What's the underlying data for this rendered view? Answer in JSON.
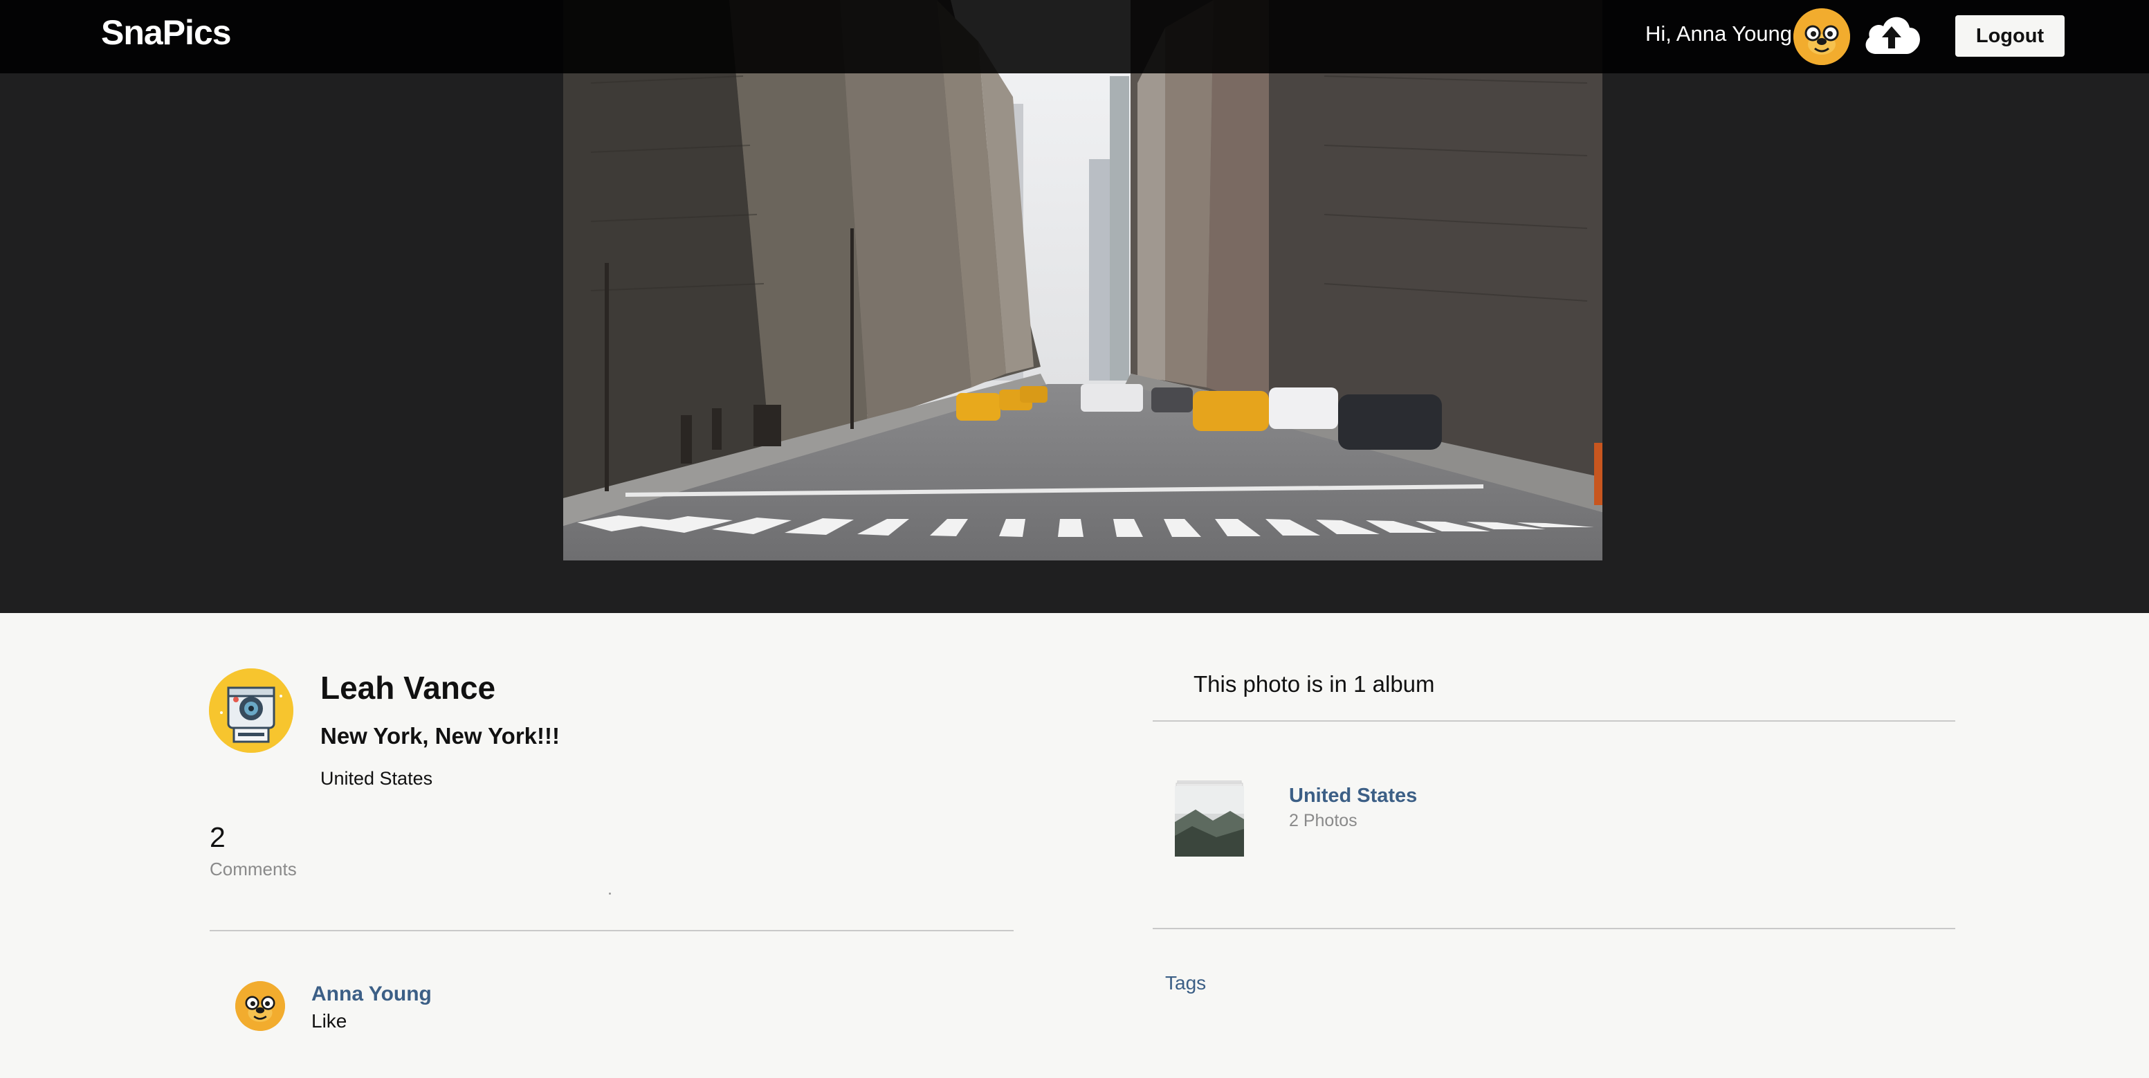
{
  "app": {
    "name": "SnaPics"
  },
  "header": {
    "greeting": "Hi, Anna Young",
    "avatar_icon": "jake-dog-avatar-icon",
    "upload_icon": "cloud-upload-icon",
    "logout_label": "Logout"
  },
  "photo": {
    "author": "Leah Vance",
    "title": "New York, New York!!!",
    "location": "United States",
    "comments_count": "2",
    "comments_label": "Comments"
  },
  "comments": [
    {
      "author": "Anna Young",
      "text": "Like"
    }
  ],
  "albums": {
    "heading": "This photo is in 1 album",
    "items": [
      {
        "name": "United States",
        "count_label": "2 Photos"
      }
    ]
  },
  "tags": {
    "label": "Tags"
  },
  "colors": {
    "topbar": "#000000",
    "hero_bg": "#1f1f20",
    "page_bg": "#f7f7f5",
    "link": "#3c5f86",
    "avatar_orange": "#f2ac2e",
    "avatar_yellow": "#f7c52e"
  }
}
